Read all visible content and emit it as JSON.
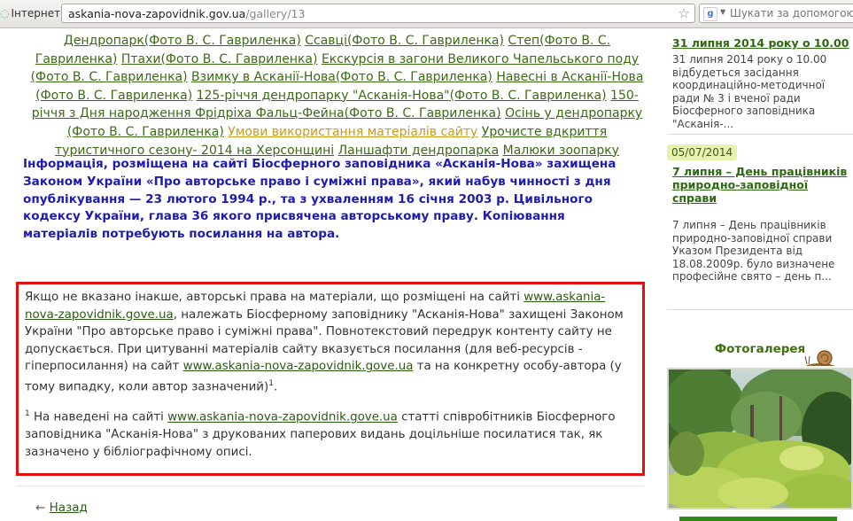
{
  "browser": {
    "connection_label": "Інтернет",
    "url_host": "askania-nova-zapovidnik.gov.ua",
    "url_path": "/gallery/13",
    "search_placeholder": "Шукати за допомогою"
  },
  "gallery_links": [
    "Дендропарк(Фото В. С. Гавриленка)",
    "Ссавці(Фото В. С. Гавриленка)",
    "Степ(Фото В. С. Гавриленка)",
    "Птахи(Фото В. С. Гавриленка)",
    "Екскурсія в загони Великого Чапельського поду (Фото В. С. Гавриленка)",
    "Взимку в Асканії-Нова(Фото В. С. Гавриленка)",
    "Навесні в Асканії-Нова (Фото В. С. Гавриленка)",
    "125-річчя дендропарку \"Асканія-Нова\"(Фото В. С. Гавриленка)",
    "150-річчя з Дня народження Фрідріха Фальц-Фейна(Фото В. С. Гавриленка)",
    "Осінь у дендропарку (Фото В. С. Гавриленка)",
    "Умови використання матеріалів сайту",
    "Урочисте вдкриття туристичного сезону- 2014 на Херсонщині",
    "Ланшафти дендропарка",
    "Малюки зоопарку"
  ],
  "copyright_notice": "Інформація, розміщена на сайті Біосферного заповідника «Асканія-Нова» захищена Законом України «Про авторське право і суміжні права», який набув чинності з дня опублікування — 23 лютого 1994 р., та з ухваленням 16 січня 2003 р. Цивільного кодексу України, глава 36 якого присвячена авторському праву. Копіювання матеріалів потребують посилання на автора.",
  "copybox": {
    "p1_a": "Якщо не вказано інакше, авторські права на матеріали, що розміщені на сайті ",
    "p1_link": "www.askania-nova-zapovidnik.gove.ua",
    "p1_b": ", належать Біосферному заповіднику \"Асканія-Нова\" захищені Законом України \"Про авторське право і суміжні права\". Повнотекстовий передрук контенту сайту не допускається. При цитуванні матеріалів сайту вказується посилання (для веб-ресурсів - гіперпосилання) на сайт ",
    "p1_link2": "www.askania-nova-zapovidnik.gove.ua",
    "p1_c": " та на конкретну особу-автора (у тому випадку, коли автор зазначений)",
    "footnote_mark": "1",
    "p1_end": ".",
    "p2_a": " На наведені на сайті ",
    "p2_link": "www.askania-nova-zapovidnik.gove.ua",
    "p2_b": "  статті співробітників Біосферного заповідника \"Асканія-Нова\" з друкованих паперових видань доцільніше посилатися так, як зазначено у бібліографічному описі."
  },
  "back": {
    "arrow": "←",
    "label": "Назад"
  },
  "sidebar": {
    "news1_title": "31 липня 2014 року о 10.00",
    "news1_text": "31 липня 2014 року о 10.00 відбудеться засідання координаційно-методичної ради № 3 і вченої ради Біосферного заповідника \"Асканія-...",
    "news2_date": "05/07/2014",
    "news2_title": "7 липня – День працівників природно-заповідної справи",
    "news2_text": "7 липня – День працівників природно-заповідної справи Указом Президента від 18.08.2009р. було визначене професійне свято – день п...",
    "gallery_heading": "Фотогалерея"
  },
  "colors": {
    "accent_green": "#2f8a17",
    "notice_blue": "#1f1cb0",
    "box_red": "#e01010",
    "active_link": "#c79a1a"
  },
  "icons": [
    "globe-icon",
    "star-icon",
    "google-icon",
    "chevron-down-icon",
    "snail-icon",
    "arrow-left-icon"
  ]
}
